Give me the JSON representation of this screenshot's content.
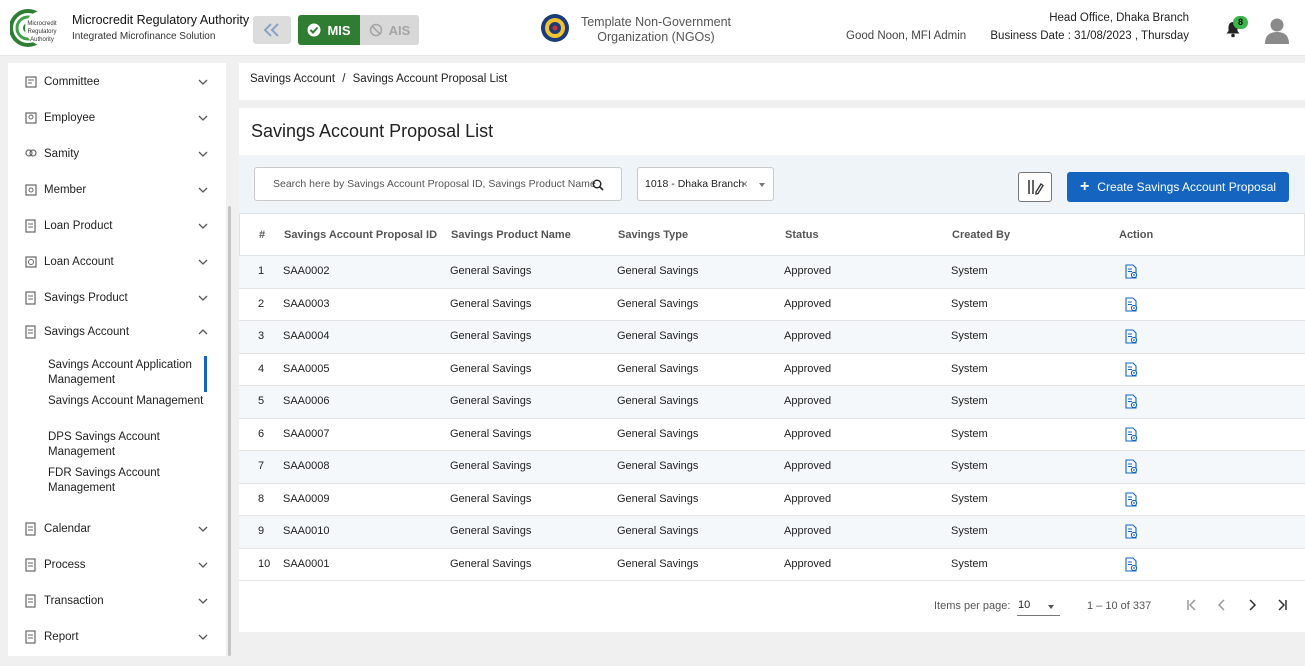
{
  "header": {
    "org_title": "Microcredit Regulatory Authority",
    "org_subtitle": "Integrated Microfinance Solution",
    "logo_text": "Microcredit Regulatory Authority",
    "mode_mis": "MIS",
    "mode_ais": "AIS",
    "ngo_name": "Template Non-Government Organization (NGOs)",
    "greeting": "Good Noon, MFI Admin",
    "branch": "Head Office, Dhaka Branch",
    "business_date": "Business Date : 31/08/2023 , Thursday",
    "notification_count": "8"
  },
  "sidebar": {
    "items": [
      {
        "label": "Committee"
      },
      {
        "label": "Employee"
      },
      {
        "label": "Samity"
      },
      {
        "label": "Member"
      },
      {
        "label": "Loan Product"
      },
      {
        "label": "Loan Account"
      },
      {
        "label": "Savings Product"
      },
      {
        "label": "Savings Account"
      },
      {
        "label": "Calendar"
      },
      {
        "label": "Process"
      },
      {
        "label": "Transaction"
      },
      {
        "label": "Report"
      }
    ],
    "savings_account_subitems": [
      {
        "label": "Savings Account Application Management"
      },
      {
        "label": "Savings Account Management"
      },
      {
        "label": "DPS Savings Account Management"
      },
      {
        "label": "FDR Savings Account Management"
      }
    ]
  },
  "breadcrumb": {
    "parent": "Savings Account",
    "separator": "/",
    "current": "Savings Account Proposal List"
  },
  "page": {
    "title": "Savings Account Proposal List",
    "search_placeholder": "Search here by Savings Account Proposal ID, Savings Product Name",
    "branch_filter": "1018 - Dhaka Branch",
    "create_button": "Create Savings Account Proposal"
  },
  "table": {
    "columns": [
      "#",
      "Savings Account Proposal ID",
      "Savings Product Name",
      "Savings Type",
      "Status",
      "Created By",
      "Action"
    ],
    "rows": [
      [
        "1",
        "SAA0002",
        "General Savings",
        "General Savings",
        "Approved",
        "System"
      ],
      [
        "2",
        "SAA0003",
        "General Savings",
        "General Savings",
        "Approved",
        "System"
      ],
      [
        "3",
        "SAA0004",
        "General Savings",
        "General Savings",
        "Approved",
        "System"
      ],
      [
        "4",
        "SAA0005",
        "General Savings",
        "General Savings",
        "Approved",
        "System"
      ],
      [
        "5",
        "SAA0006",
        "General Savings",
        "General Savings",
        "Approved",
        "System"
      ],
      [
        "6",
        "SAA0007",
        "General Savings",
        "General Savings",
        "Approved",
        "System"
      ],
      [
        "7",
        "SAA0008",
        "General Savings",
        "General Savings",
        "Approved",
        "System"
      ],
      [
        "8",
        "SAA0009",
        "General Savings",
        "General Savings",
        "Approved",
        "System"
      ],
      [
        "9",
        "SAA0010",
        "General Savings",
        "General Savings",
        "Approved",
        "System"
      ],
      [
        "10",
        "SAA0001",
        "General Savings",
        "General Savings",
        "Approved",
        "System"
      ]
    ]
  },
  "pagination": {
    "items_per_page_label": "Items per page:",
    "items_per_page": "10",
    "range": "1 – 10 of 337"
  },
  "colors": {
    "primary": "#1565c0",
    "mis_green": "#2f7d32",
    "badge_green": "#3bb54a"
  }
}
